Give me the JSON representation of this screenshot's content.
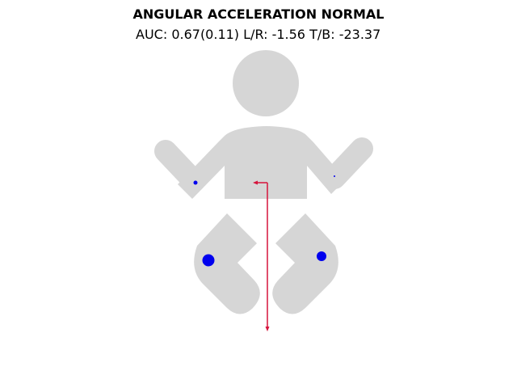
{
  "title": "ANGULAR ACCELERATION NORMAL",
  "subtitle": {
    "auc_label": "AUC:",
    "auc_value": "0.67(0.11)",
    "lr_label": "L/R:",
    "lr_value": "-1.56",
    "tb_label": "T/B:",
    "tb_value": "-23.37"
  },
  "colors": {
    "silhouette": "#d6d6d6",
    "markers": "#0000ee",
    "arrow": "#d6143c"
  },
  "chart_data": {
    "type": "scatter",
    "title": "ANGULAR ACCELERATION NORMAL",
    "subtitle": "AUC: 0.67(0.11) L/R: -1.56 T/B: -23.37",
    "background_icon": "baby-silhouette",
    "points": [
      {
        "location": "left-hand",
        "relative_size": "small"
      },
      {
        "location": "right-hand",
        "relative_size": "tiny"
      },
      {
        "location": "left-leg",
        "relative_size": "large"
      },
      {
        "location": "right-leg",
        "relative_size": "medium"
      }
    ],
    "arrow_vectors": {
      "left_right": -1.56,
      "top_bottom": -23.37
    }
  }
}
